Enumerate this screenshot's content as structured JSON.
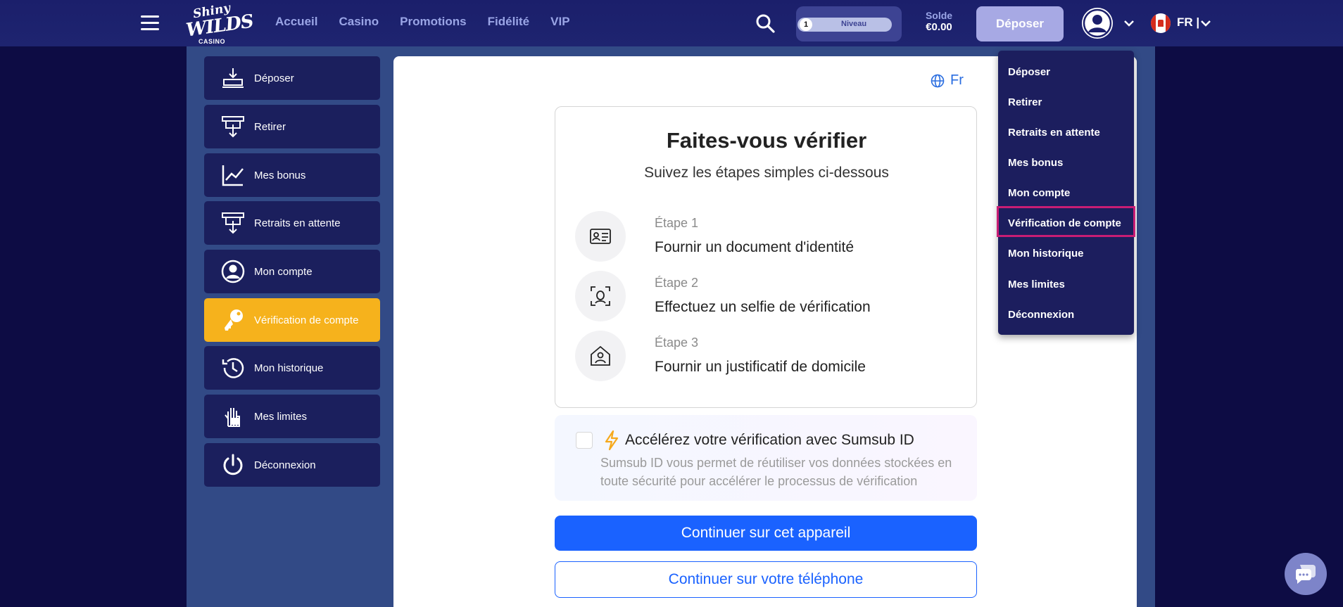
{
  "brand": {
    "line1": "Shiny",
    "line2": "WILDS",
    "line3": "CASINO"
  },
  "nav": [
    "Accueil",
    "Casino",
    "Promotions",
    "Fidélité",
    "VIP"
  ],
  "level": {
    "number": "1",
    "label": "Niveau"
  },
  "balance": {
    "label": "Solde",
    "value": "€0.00"
  },
  "header_deposit": "Déposer",
  "language": "FR |",
  "sidebar": [
    {
      "label": "Déposer",
      "icon": "deposit-icon"
    },
    {
      "label": "Retirer",
      "icon": "withdraw-icon"
    },
    {
      "label": "Mes bonus",
      "icon": "chart-icon"
    },
    {
      "label": "Retraits en attente",
      "icon": "pending-withdraw-icon"
    },
    {
      "label": "Mon compte",
      "icon": "account-icon"
    },
    {
      "label": "Vérification de compte",
      "icon": "key-icon"
    },
    {
      "label": "Mon historique",
      "icon": "history-icon"
    },
    {
      "label": "Mes limites",
      "icon": "hand-limit-icon"
    },
    {
      "label": "Déconnexion",
      "icon": "power-icon"
    }
  ],
  "verify": {
    "lang": "Fr",
    "title": "Faites-vous vérifier",
    "subtitle": "Suivez les étapes simples ci-dessous",
    "steps": [
      {
        "number": "Étape 1",
        "text": "Fournir un document d'identité",
        "icon": "id-card-icon"
      },
      {
        "number": "Étape 2",
        "text": "Effectuez un selfie de vérification",
        "icon": "face-scan-icon"
      },
      {
        "number": "Étape 3",
        "text": "Fournir un justificatif de domicile",
        "icon": "home-user-icon"
      }
    ],
    "sumsub_title": "Accélérez votre vérification avec Sumsub ID",
    "sumsub_desc": "Sumsub ID vous permet de réutiliser vos données stockées en toute sécurité pour accélérer le processus de vérification",
    "btn_device": "Continuer sur cet appareil",
    "btn_phone": "Continuer sur votre téléphone"
  },
  "dropdown": [
    "Déposer",
    "Retirer",
    "Retraits en attente",
    "Mes bonus",
    "Mon compte",
    "Vérification de compte",
    "Mon historique",
    "Mes limites",
    "Déconnexion"
  ],
  "colors": {
    "accent": "#f6b21c",
    "primary": "#1a62ff",
    "highlight": "#c81d74"
  }
}
